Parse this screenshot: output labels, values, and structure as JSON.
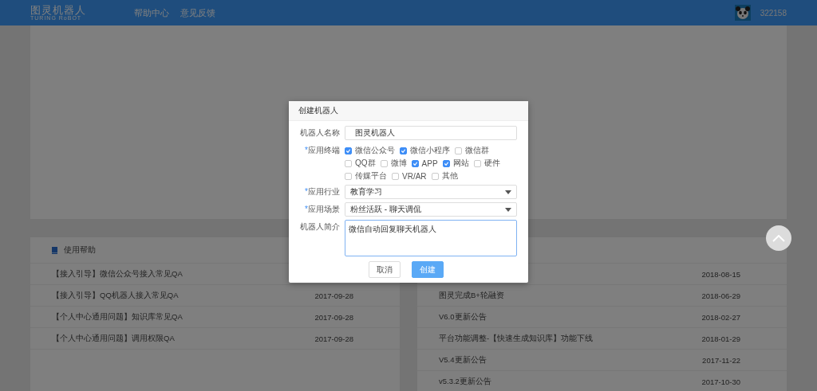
{
  "header": {
    "logo": {
      "title": "图灵机器人",
      "subtitle": "TURING RoBOT"
    },
    "nav": [
      "帮助中心",
      "意见反馈"
    ],
    "user": {
      "id": "322158"
    }
  },
  "modal": {
    "title": "创建机器人",
    "fields": [
      {
        "kind": "text",
        "label": "机器人名称",
        "value": "图灵机器人"
      },
      {
        "kind": "checkboxes",
        "label": "应用终端",
        "required_mark": "*",
        "options": [
          {
            "label": "微信公众号",
            "checked": true
          },
          {
            "label": "微信小程序",
            "checked": true
          },
          {
            "label": "微信群",
            "checked": false
          },
          {
            "label": "QQ群",
            "checked": false
          },
          {
            "label": "微博",
            "checked": false
          },
          {
            "label": "APP",
            "checked": true
          },
          {
            "label": "网站",
            "checked": true
          },
          {
            "label": "硬件",
            "checked": false
          },
          {
            "label": "传媒平台",
            "checked": false
          },
          {
            "label": "VR/AR",
            "checked": false
          },
          {
            "label": "其他",
            "checked": false
          }
        ]
      },
      {
        "kind": "select",
        "label": "应用行业",
        "required_mark": "*",
        "value": "教育学习"
      },
      {
        "kind": "select",
        "label": "应用场景",
        "required_mark": "*",
        "value": "粉丝活跃 - 聊天调侃"
      },
      {
        "kind": "textarea",
        "label": "机器人简介",
        "value": "微信自动回复聊天机器人"
      }
    ],
    "buttons": [
      {
        "label": "取消",
        "kind": "default"
      },
      {
        "label": "创建",
        "kind": "primary"
      }
    ]
  },
  "help_panel": {
    "title": "使用帮助",
    "items": [
      {
        "title": "【接入引导】微信公众号接入常见QA"
      },
      {
        "title": "【接入引导】QQ机器人接入常见QA",
        "date": "2017-09-28"
      },
      {
        "title": "【个人中心通用问题】知识库常见QA",
        "date": "2017-09-28"
      },
      {
        "title": "【个人中心通用问题】调用权限QA",
        "date": "2017-09-28"
      }
    ]
  },
  "news_panel": {
    "items": [
      {
        "date": "2018-08-15"
      },
      {
        "title": "图灵完成B+轮融资",
        "date": "2018-06-29"
      },
      {
        "title": "V6.0更新公告",
        "date": "2018-02-27"
      },
      {
        "title": "平台功能调整-【快速生成知识库】功能下线",
        "date": "2018-01-29"
      },
      {
        "title": "V5.4更新公告",
        "date": "2017-11-22"
      },
      {
        "title": "v5.3.2更新公告",
        "date": "2017-10-30"
      }
    ]
  }
}
